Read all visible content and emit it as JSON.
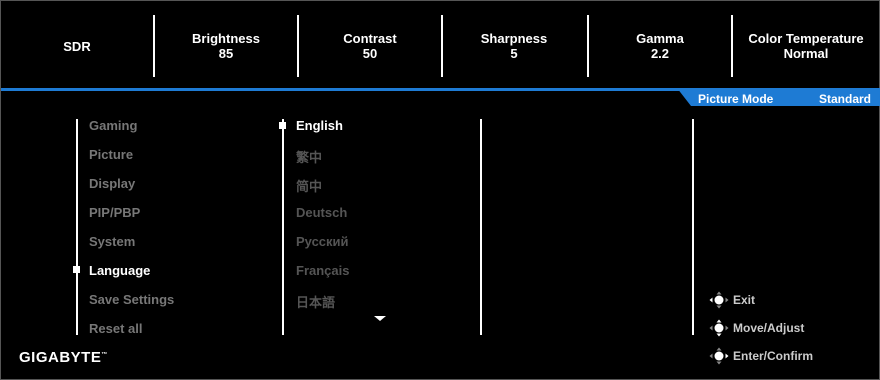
{
  "status_bar": {
    "items": [
      {
        "label": "SDR",
        "value": ""
      },
      {
        "label": "Brightness",
        "value": "85"
      },
      {
        "label": "Contrast",
        "value": "50"
      },
      {
        "label": "Sharpness",
        "value": "5"
      },
      {
        "label": "Gamma",
        "value": "2.2"
      },
      {
        "label": "Color Temperature",
        "value": "Normal"
      }
    ]
  },
  "picture_mode": {
    "label": "Picture Mode",
    "value": "Standard"
  },
  "menu": {
    "items": [
      {
        "label": "Gaming"
      },
      {
        "label": "Picture"
      },
      {
        "label": "Display"
      },
      {
        "label": "PIP/PBP"
      },
      {
        "label": "System"
      },
      {
        "label": "Language"
      },
      {
        "label": "Save Settings"
      },
      {
        "label": "Reset all"
      }
    ],
    "selected": "Language"
  },
  "languages": {
    "items": [
      {
        "label": "English"
      },
      {
        "label": "繁中"
      },
      {
        "label": "简中"
      },
      {
        "label": "Deutsch"
      },
      {
        "label": "Русский"
      },
      {
        "label": "Français"
      },
      {
        "label": "日本語"
      }
    ],
    "selected": "English"
  },
  "hints": {
    "exit": "Exit",
    "move_adjust": "Move/Adjust",
    "enter_confirm": "Enter/Confirm"
  },
  "brand": {
    "logo_text": "GIGABYTE",
    "trademark": "™"
  },
  "colors": {
    "accent": "#1e7bd4",
    "background": "#000000",
    "inactive_text": "#777777"
  }
}
